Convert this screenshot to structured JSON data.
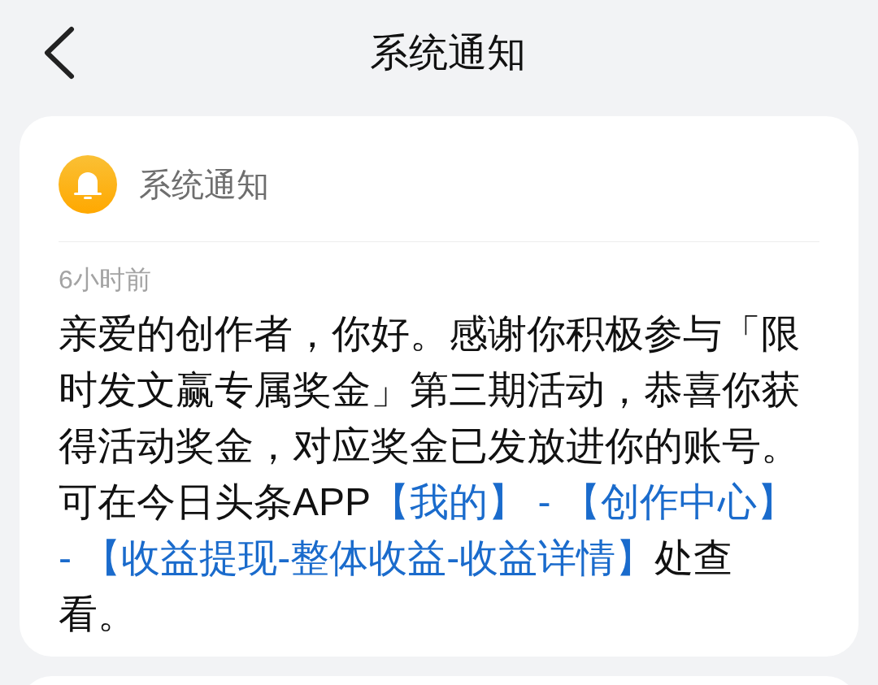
{
  "header": {
    "title": "系统通知"
  },
  "notification": {
    "source": "系统通知",
    "time": "6小时前",
    "body": [
      {
        "kind": "text",
        "text": "亲爱的创作者，你好。感谢你积极参与「限时发文赢专属奖金」第三期活动，恭喜你获得活动奖金，对应奖金已发放进你的账号。可在今日头条APP"
      },
      {
        "kind": "link",
        "text": "【我的】"
      },
      {
        "kind": "separator",
        "text": " - "
      },
      {
        "kind": "link",
        "text": "【创作中心】"
      },
      {
        "kind": "separator",
        "text": " - "
      },
      {
        "kind": "link",
        "text": "【收益提现-整体收益-收益详情】"
      },
      {
        "kind": "text",
        "text": "处查看。"
      }
    ]
  }
}
